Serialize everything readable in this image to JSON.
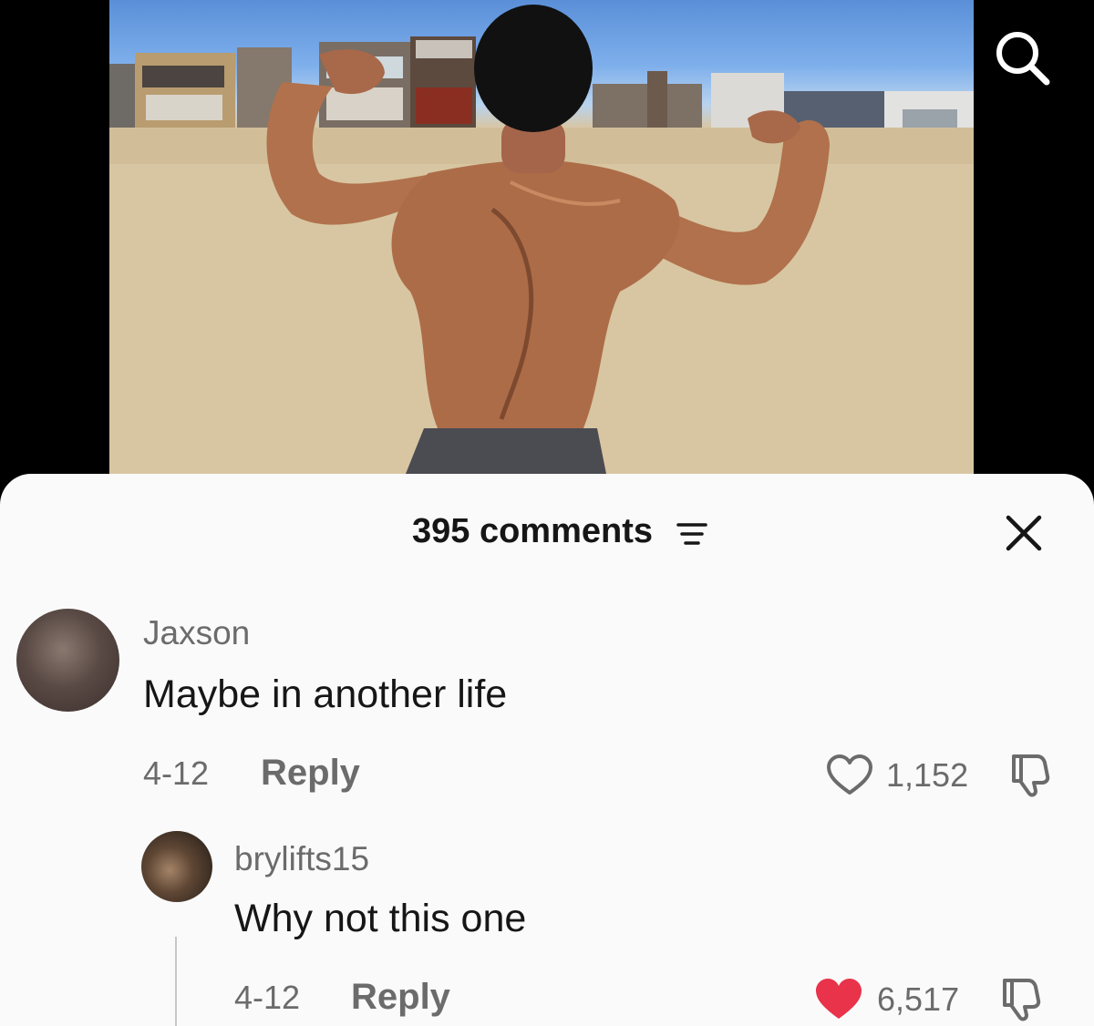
{
  "video": {
    "search_icon": "search-icon"
  },
  "sheet": {
    "comments_count": "395 comments",
    "sort_icon": "sort-lines-icon",
    "close_icon": "close-icon"
  },
  "comments": [
    {
      "username": "Jaxson",
      "text": "Maybe in another life",
      "date": "4-12",
      "reply_label": "Reply",
      "likes": "1,152",
      "liked": false
    },
    {
      "username": "brylifts15",
      "text": "Why not this one",
      "date": "4-12",
      "reply_label": "Reply",
      "likes": "6,517",
      "liked": true
    }
  ],
  "colors": {
    "liked_heart": "#e8334a",
    "sheet_bg": "#fafafa",
    "text_primary": "#161616",
    "text_secondary": "#6b6b6b"
  }
}
